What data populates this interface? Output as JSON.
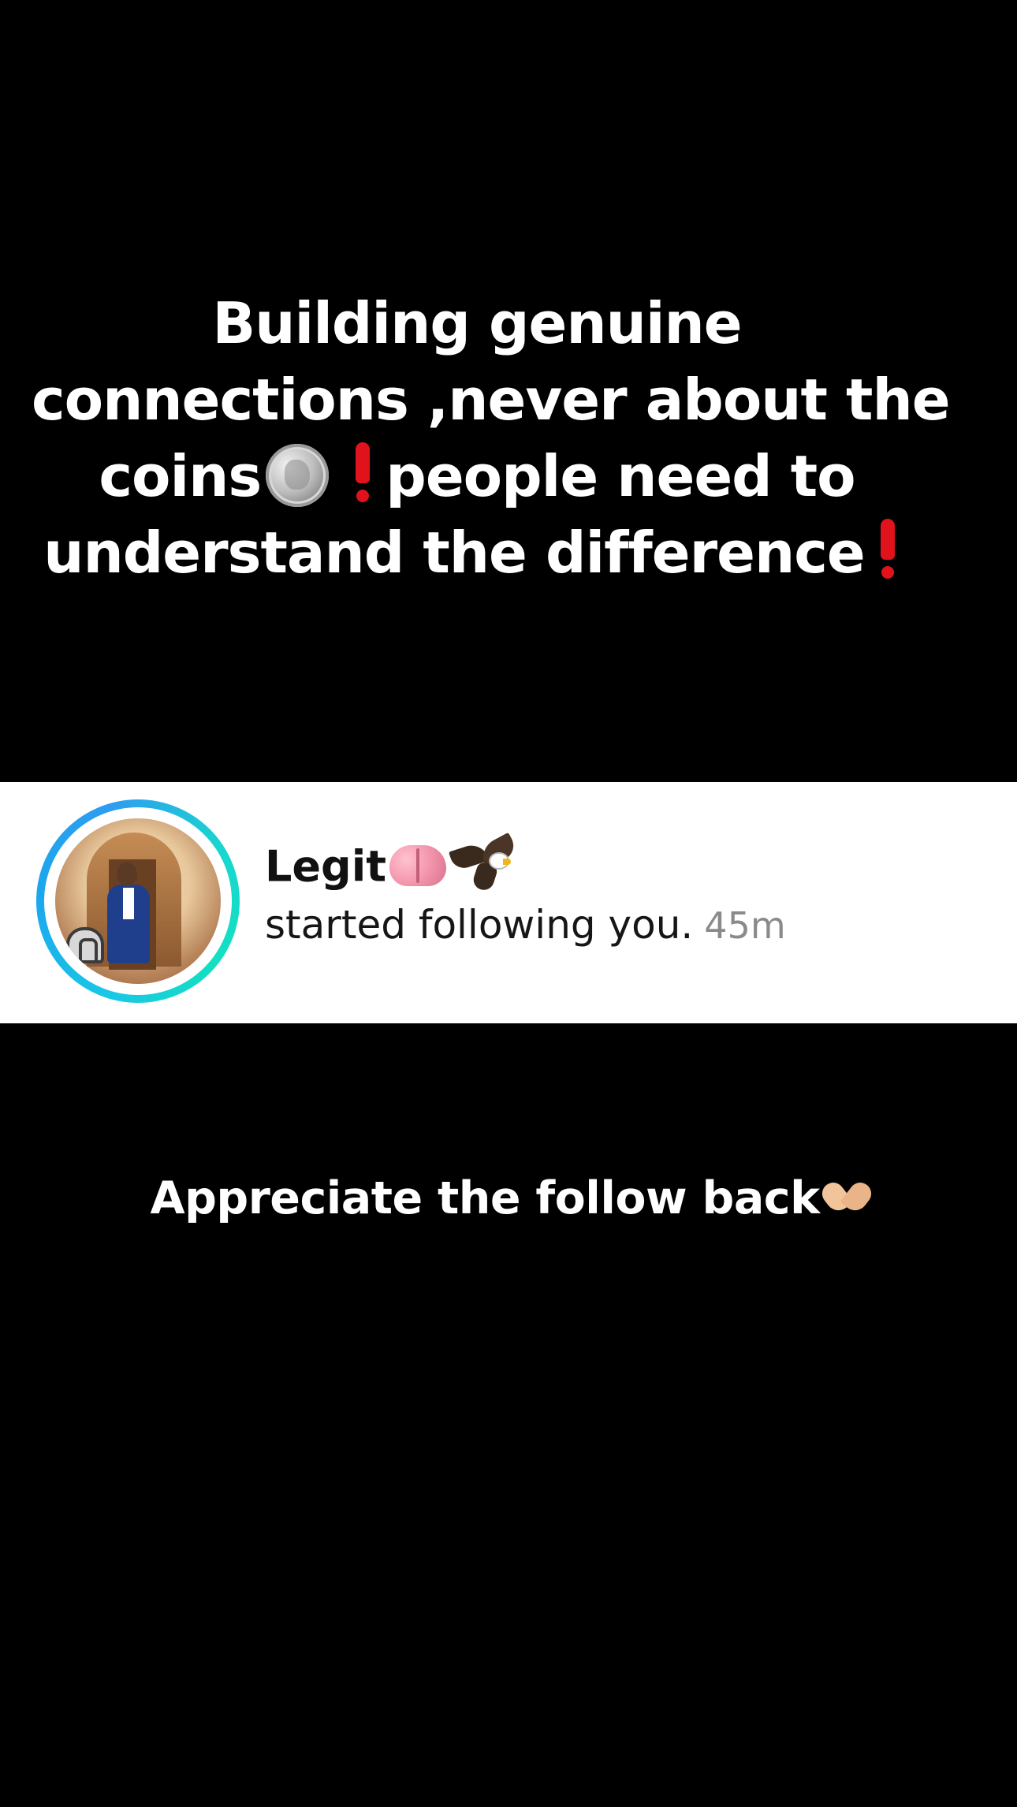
{
  "overlay_text": {
    "line1": "Building genuine",
    "line2": "connections ,never about the",
    "line3_part1": "coins",
    "line3_part2": "people need to",
    "line4": "understand the difference"
  },
  "notification": {
    "username": "Legit",
    "action_text": "started following you.",
    "time_ago": "45m",
    "ring_colors": [
      "#19c7e6",
      "#12e0c0",
      "#2f9cf0"
    ]
  },
  "caption": {
    "text": "Appreciate the follow back"
  },
  "icons": {
    "coin": "silver-coin-icon",
    "exclamation": "red-exclamation-icon",
    "brain": "brain-icon",
    "eagle": "eagle-icon",
    "heart_hands": "heart-hands-icon"
  },
  "colors": {
    "background": "#000000",
    "text": "#ffffff",
    "exclamation": "#e0121b",
    "card_background": "#ffffff",
    "time_text": "#8a8a8a"
  }
}
